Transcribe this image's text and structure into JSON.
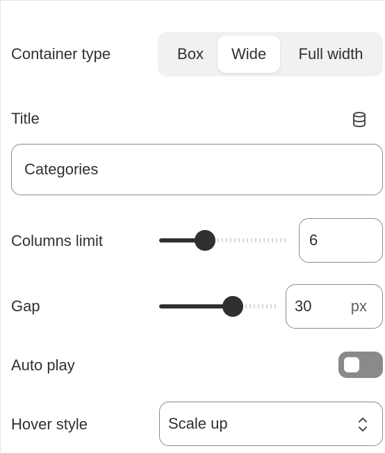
{
  "container_type": {
    "label": "Container type",
    "options": [
      "Box",
      "Wide",
      "Full width"
    ],
    "selected": "Wide"
  },
  "title_field": {
    "label": "Title",
    "value": "Categories",
    "icon": "database-icon"
  },
  "columns_limit": {
    "label": "Columns limit",
    "value": "6",
    "slider_fraction": 0.36
  },
  "gap": {
    "label": "Gap",
    "value": "30",
    "unit": "px",
    "slider_fraction": 0.65
  },
  "auto_play": {
    "label": "Auto play",
    "enabled": false
  },
  "hover_style": {
    "label": "Hover style",
    "value": "Scale up",
    "icon": "chevron-up-down-icon"
  },
  "colors": {
    "text": "#303030",
    "border": "#8a8a8a",
    "segment_bg": "#f1f1f1",
    "toggle_off": "#8a8a8a"
  }
}
